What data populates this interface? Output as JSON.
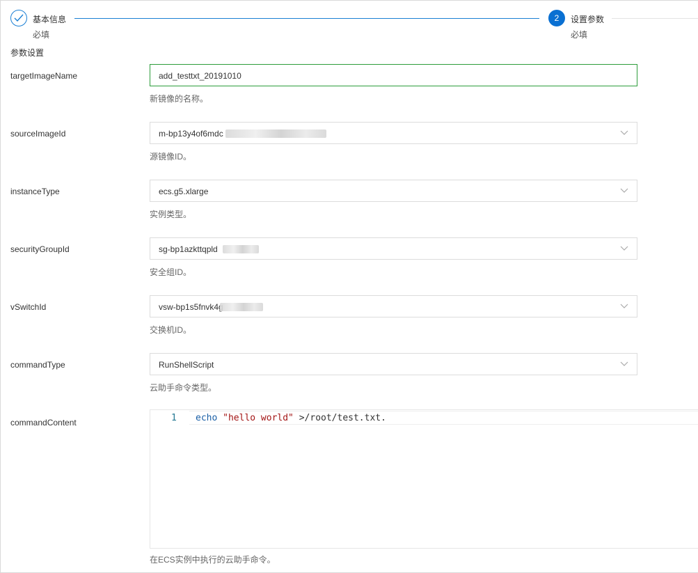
{
  "steps": [
    {
      "number": "",
      "title": "基本信息",
      "subtitle": "必填",
      "state": "done"
    },
    {
      "number": "2",
      "title": "设置参数",
      "subtitle": "必填",
      "state": "active"
    }
  ],
  "section_title": "参数设置",
  "fields": {
    "targetImageName": {
      "label": "targetImageName",
      "value": "add_testtxt_20191010",
      "hint": "新镜像的名称。"
    },
    "sourceImageId": {
      "label": "sourceImageId",
      "value": "m-bp13y4of6mdc",
      "hint": "源镜像ID。"
    },
    "instanceType": {
      "label": "instanceType",
      "value": "ecs.g5.xlarge",
      "hint": "实例类型。"
    },
    "securityGroupId": {
      "label": "securityGroupId",
      "value": "sg-bp1azkttqpld",
      "hint": "安全组ID。"
    },
    "vSwitchId": {
      "label": "vSwitchId",
      "value": "vsw-bp1s5fnvk4g",
      "hint": "交换机ID。"
    },
    "commandType": {
      "label": "commandType",
      "value": "RunShellScript",
      "hint": "云助手命令类型。"
    },
    "commandContent": {
      "label": "commandContent",
      "line_number": "1",
      "code": {
        "keyword": "echo",
        "string": "\"hello world\"",
        "rest": " >/root/test.txt."
      },
      "hint": "在ECS实例中执行的云助手命令。"
    }
  },
  "colors": {
    "accent": "#0a70d2",
    "active_border": "#2c9c3a"
  },
  "icons": {
    "step_done": "check-icon",
    "dropdown": "chevron-down-icon"
  }
}
